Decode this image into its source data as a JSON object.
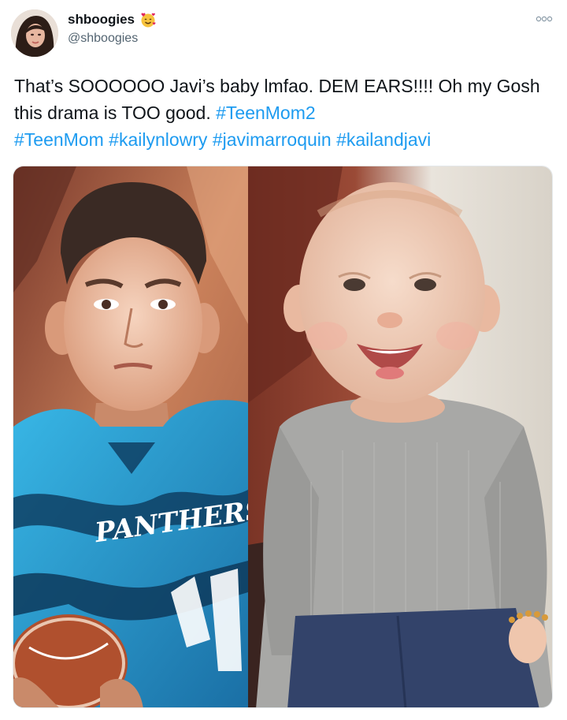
{
  "user": {
    "display_name": "shboogies",
    "handle": "@shboogies",
    "emoji": "smiling-face-with-hearts-emoji",
    "avatar": "user-avatar"
  },
  "tweet": {
    "text_plain": "That’s SOOOOOO Javi’s baby lmfao. DEM EARS!!!! Oh my Gosh this drama is TOO good.",
    "hashtags": [
      "#TeenMom2",
      "#TeenMom",
      "#kailynlowry",
      "#javimarroquin",
      "#kailandjavi"
    ]
  },
  "media": {
    "left_photo": "illustrated portrait of a boy in a Panthers jersey holding a football",
    "right_photo": "smiling baby in a gray shirt and jeans",
    "jersey_text": "PANTHERS"
  },
  "icons": {
    "more": "more-options-icon"
  }
}
